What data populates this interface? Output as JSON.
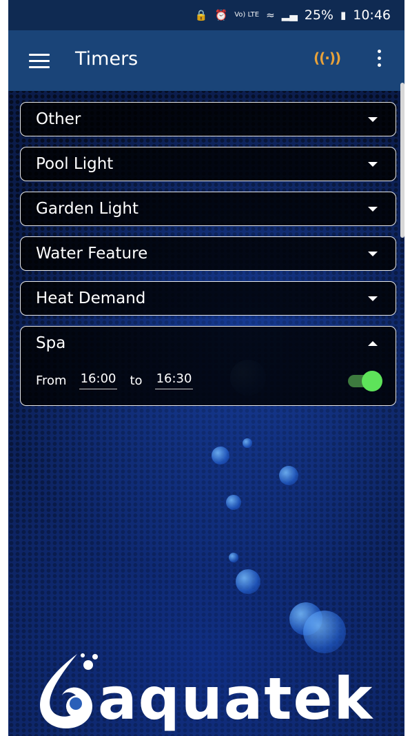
{
  "status_bar": {
    "battery_pct": "25%",
    "time": "10:46",
    "icons": [
      "lock-icon",
      "alarm-icon",
      "volte-icon",
      "wifi-icon",
      "signal-icon",
      "battery-icon"
    ],
    "volte_text": "Vo) LTE"
  },
  "appbar": {
    "title": "Timers",
    "signal_symbol": "((·))",
    "accent_color": "#e8a23a"
  },
  "timers": [
    {
      "label": "Other"
    },
    {
      "label": "Pool Light"
    },
    {
      "label": "Garden Light"
    },
    {
      "label": "Water Feature"
    },
    {
      "label": "Heat Demand"
    },
    {
      "label": "Spa"
    }
  ],
  "spa": {
    "from_label": "From",
    "from_time": "16:00",
    "to_label": "to",
    "to_time": "16:30",
    "enabled": true,
    "toggle_color": "#5ee35a"
  },
  "logo": {
    "text": "aquatek"
  }
}
